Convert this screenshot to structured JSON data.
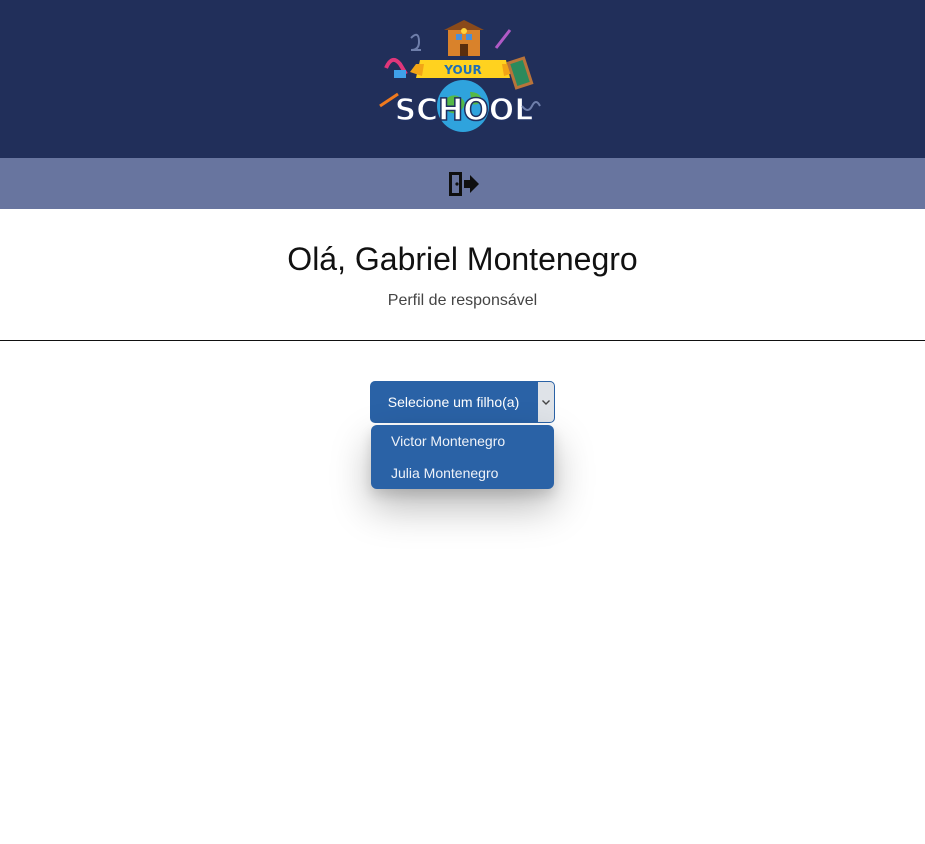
{
  "header": {
    "logo_alt": "Your School",
    "logo_text_top": "YOUR",
    "logo_text_main": "SCHOOL"
  },
  "nav": {
    "logout_icon": "logout-door-icon"
  },
  "greeting": {
    "title": "Olá, Gabriel Montenegro",
    "subtitle": "Perfil de responsável"
  },
  "child_select": {
    "label": "Selecione um filho(a)",
    "options": [
      "Victor Montenegro",
      "Julia Montenegro"
    ]
  },
  "colors": {
    "header_bg": "#212f5a",
    "nav_bg": "#68759f",
    "button_bg": "#2a62a6"
  }
}
